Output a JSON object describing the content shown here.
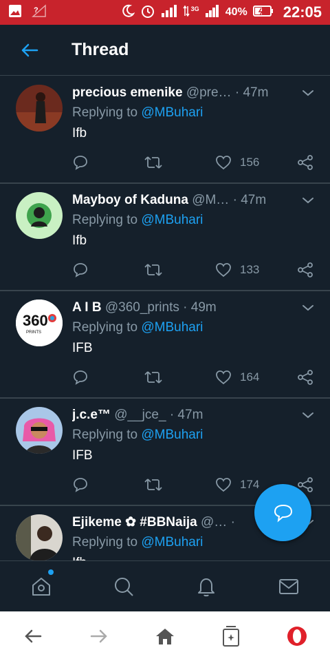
{
  "status_bar": {
    "battery": "40%",
    "network": "3G",
    "time": "22:05",
    "color": "#c8232c"
  },
  "header": {
    "title": "Thread",
    "back_icon": "arrow-left-icon",
    "accent": "#1da1f2"
  },
  "tweets": [
    {
      "name": "precious emenike",
      "handle": "@pre…",
      "time": "· 47m",
      "replying_prefix": "Replying to",
      "replying_to": "@MBuhari",
      "text": "Ifb",
      "likes": "156"
    },
    {
      "name": "Mayboy of Kaduna",
      "handle": "@M…",
      "time": "· 47m",
      "replying_prefix": "Replying to",
      "replying_to": "@MBuhari",
      "text": "Ifb",
      "likes": "133"
    },
    {
      "name": "A I B",
      "handle": "@360_prints",
      "time": "· 49m",
      "replying_prefix": "Replying to",
      "replying_to": "@MBuhari",
      "text": "IFB",
      "likes": "164",
      "avatar_logo": "360",
      "avatar_sub": "PRINTS"
    },
    {
      "name": "j.c.e™",
      "handle": "@__jce_",
      "time": "· 47m",
      "replying_prefix": "Replying to",
      "replying_to": "@MBuhari",
      "text": "IFB",
      "likes": "174"
    },
    {
      "name": "Ejikeme ✿ #BBNaija",
      "handle": "@…",
      "time": "·",
      "replying_prefix": "Replying to",
      "replying_to": "@MBuhari",
      "text": "Ifb",
      "likes": ""
    }
  ],
  "tab_bar": {
    "items": [
      "home-icon",
      "search-icon",
      "notifications-icon",
      "messages-icon"
    ]
  },
  "browser_bar": {
    "items": [
      "back-icon",
      "forward-icon",
      "home-icon",
      "tabs-icon",
      "opera-icon"
    ]
  }
}
